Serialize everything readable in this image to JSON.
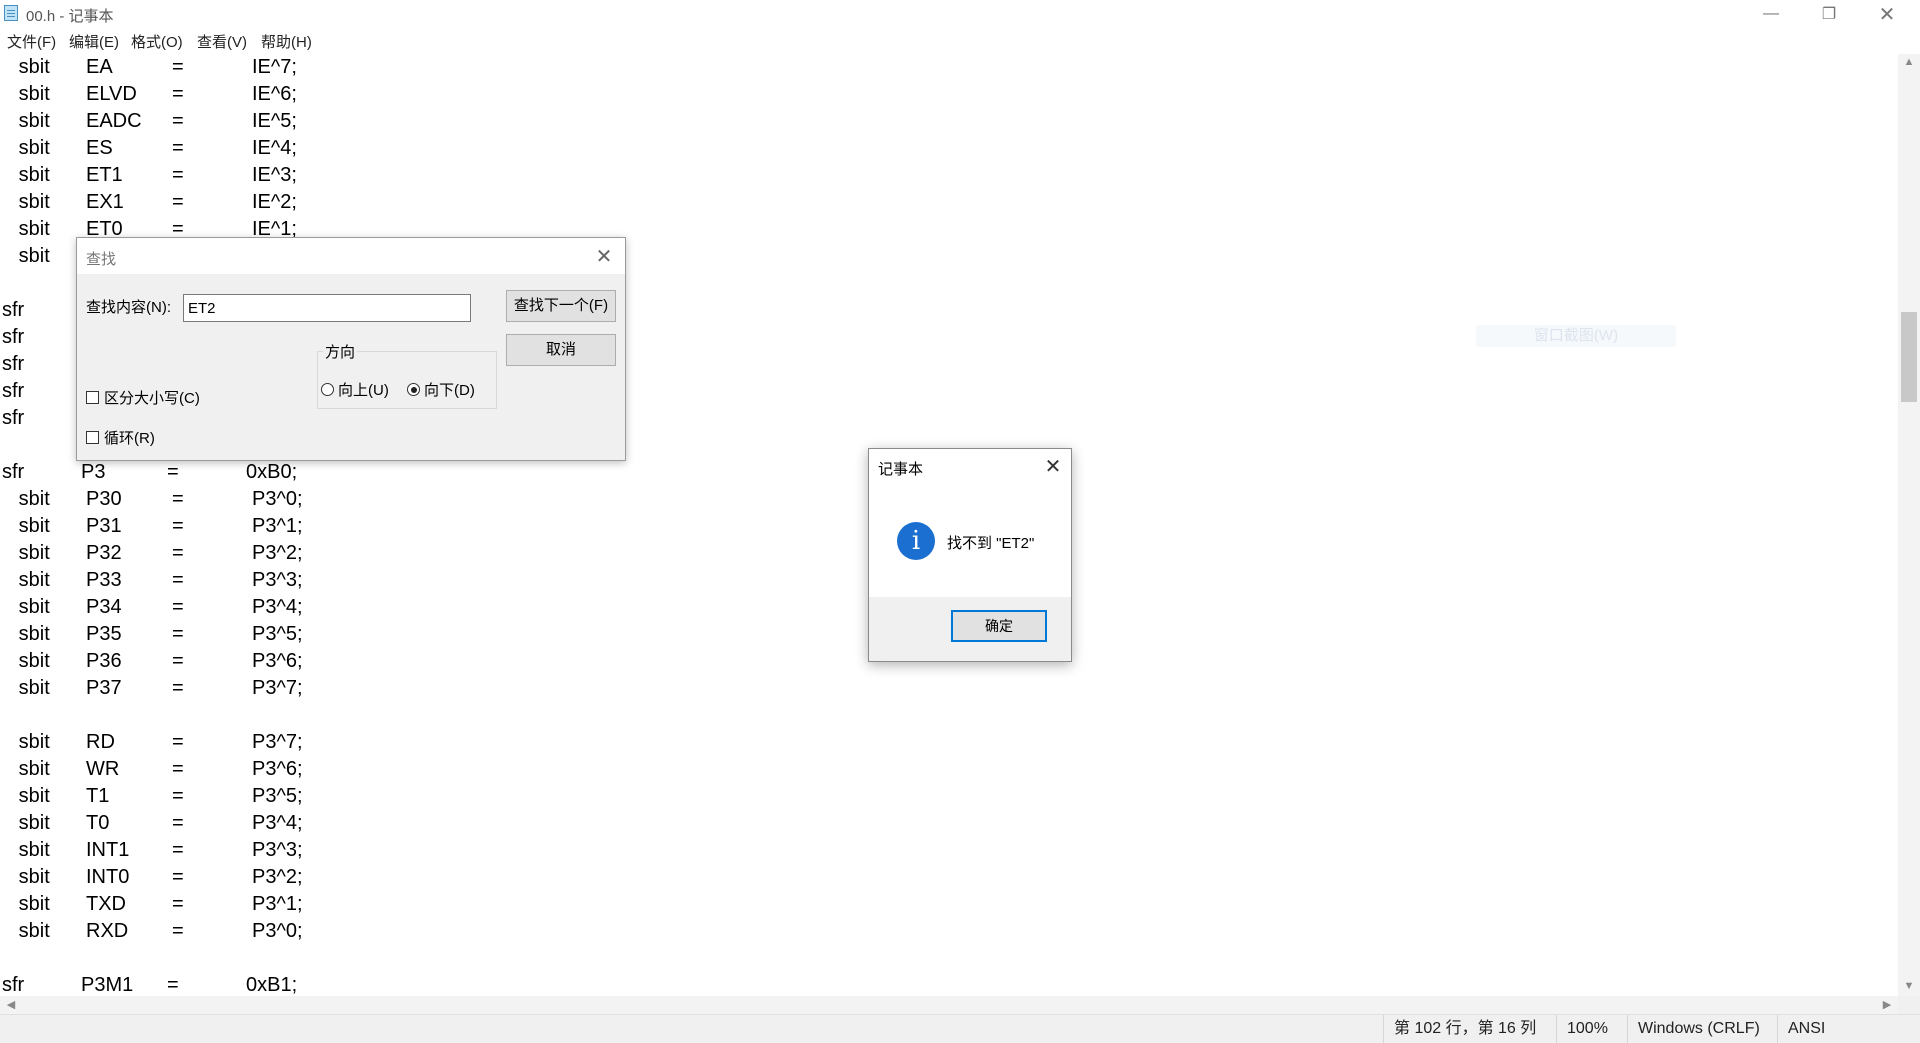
{
  "window": {
    "title": "00.h - 记事本",
    "minimize": "—",
    "maximize": "❐",
    "close": "✕"
  },
  "menu": [
    "文件(F)",
    "编辑(E)",
    "格式(O)",
    "查看(V)",
    "帮助(H)"
  ],
  "editor_lines": [
    {
      "kw": "   sbit",
      "name": "EA",
      "eq": "=",
      "val": "IE^7;"
    },
    {
      "kw": "   sbit",
      "name": "ELVD",
      "eq": "=",
      "val": "IE^6;"
    },
    {
      "kw": "   sbit",
      "name": "EADC",
      "eq": "=",
      "val": "IE^5;"
    },
    {
      "kw": "   sbit",
      "name": "ES",
      "eq": "=",
      "val": "IE^4;"
    },
    {
      "kw": "   sbit",
      "name": "ET1",
      "eq": "=",
      "val": "IE^3;"
    },
    {
      "kw": "   sbit",
      "name": "EX1",
      "eq": "=",
      "val": "IE^2;"
    },
    {
      "kw": "   sbit",
      "name": "ET0",
      "eq": "=",
      "val": "IE^1;"
    },
    {
      "kw": "   sbit",
      "name": "",
      "eq": "",
      "val": ""
    },
    {
      "kw": "",
      "name": "",
      "eq": "",
      "val": ""
    },
    {
      "kw": "sfr",
      "name": "",
      "eq": "",
      "val": ""
    },
    {
      "kw": "sfr",
      "name": "",
      "eq": "",
      "val": ""
    },
    {
      "kw": "sfr",
      "name": "",
      "eq": "",
      "val": ""
    },
    {
      "kw": "sfr",
      "name": "",
      "eq": "",
      "val": ""
    },
    {
      "kw": "sfr",
      "name": "",
      "eq": "",
      "val": ""
    },
    {
      "kw": "",
      "name": "",
      "eq": "",
      "val": ""
    },
    {
      "kw": "sfr",
      "name": "P3",
      "eq": "=",
      "val": "0xB0;"
    },
    {
      "kw": "   sbit",
      "name": "P30",
      "eq": "=",
      "val": "P3^0;"
    },
    {
      "kw": "   sbit",
      "name": "P31",
      "eq": "=",
      "val": "P3^1;"
    },
    {
      "kw": "   sbit",
      "name": "P32",
      "eq": "=",
      "val": "P3^2;"
    },
    {
      "kw": "   sbit",
      "name": "P33",
      "eq": "=",
      "val": "P3^3;"
    },
    {
      "kw": "   sbit",
      "name": "P34",
      "eq": "=",
      "val": "P3^4;"
    },
    {
      "kw": "   sbit",
      "name": "P35",
      "eq": "=",
      "val": "P3^5;"
    },
    {
      "kw": "   sbit",
      "name": "P36",
      "eq": "=",
      "val": "P3^6;"
    },
    {
      "kw": "   sbit",
      "name": "P37",
      "eq": "=",
      "val": "P3^7;"
    },
    {
      "kw": "",
      "name": "",
      "eq": "",
      "val": ""
    },
    {
      "kw": "   sbit",
      "name": "RD",
      "eq": "=",
      "val": "P3^7;"
    },
    {
      "kw": "   sbit",
      "name": "WR",
      "eq": "=",
      "val": "P3^6;"
    },
    {
      "kw": "   sbit",
      "name": "T1",
      "eq": "=",
      "val": "P3^5;"
    },
    {
      "kw": "   sbit",
      "name": "T0",
      "eq": "=",
      "val": "P3^4;"
    },
    {
      "kw": "   sbit",
      "name": "INT1",
      "eq": "=",
      "val": "P3^3;"
    },
    {
      "kw": "   sbit",
      "name": "INT0",
      "eq": "=",
      "val": "P3^2;"
    },
    {
      "kw": "   sbit",
      "name": "TXD",
      "eq": "=",
      "val": "P3^1;"
    },
    {
      "kw": "   sbit",
      "name": "RXD",
      "eq": "=",
      "val": "P3^0;"
    },
    {
      "kw": "",
      "name": "",
      "eq": "",
      "val": ""
    },
    {
      "kw": "sfr",
      "name": "P3M1",
      "eq": "=",
      "val": "0xB1;"
    }
  ],
  "ghost_hint": "窗口截图(W)",
  "find_dialog": {
    "title": "查找",
    "close": "✕",
    "label": "查找内容(N):",
    "value": "ET2",
    "find_next": "查找下一个(F)",
    "cancel": "取消",
    "direction_label": "方向",
    "up": "向上(U)",
    "down": "向下(D)",
    "match_case": "区分大小写(C)",
    "wrap": "循环(R)"
  },
  "message_box": {
    "title": "记事本",
    "close": "✕",
    "icon": "i",
    "message": "找不到 \"ET2\"",
    "ok": "确定"
  },
  "status": {
    "position": "第 102 行，第 16 列",
    "zoom": "100%",
    "line_ending": "Windows (CRLF)",
    "encoding": "ANSI"
  },
  "scroll_arrows": {
    "up": "▲",
    "down": "▼",
    "left": "◀",
    "right": "▶"
  }
}
